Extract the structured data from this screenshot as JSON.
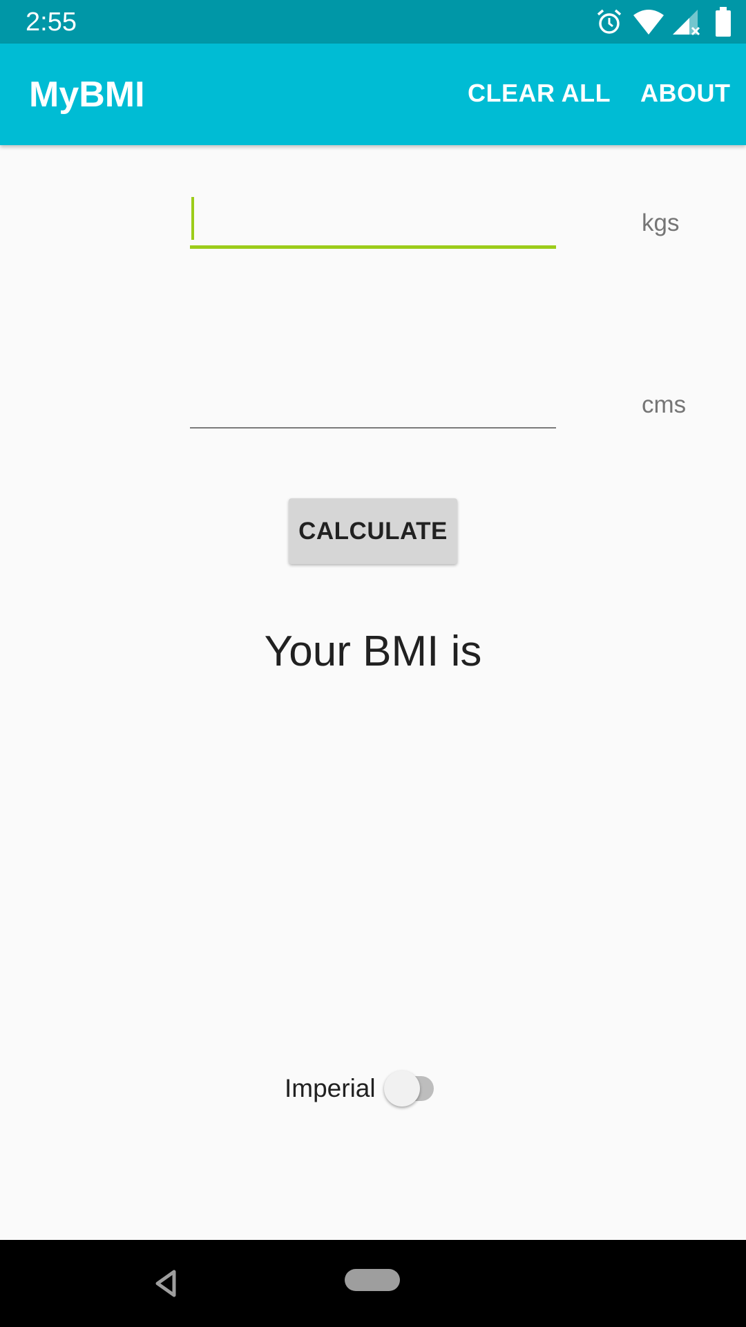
{
  "status_bar": {
    "time": "2:55",
    "icons": [
      "alarm-icon",
      "wifi-icon",
      "signal-icon",
      "battery-icon"
    ],
    "background": "#0097a7"
  },
  "app_bar": {
    "title": "MyBMI",
    "actions": [
      "CLEAR ALL",
      "ABOUT"
    ],
    "background": "#00bcd4"
  },
  "form": {
    "weight": {
      "value": "",
      "unit": "kgs",
      "focused": true,
      "accent": "#9ccc1a"
    },
    "height": {
      "value": "",
      "unit": "cms",
      "focused": false
    },
    "calculate_label": "CALCULATE"
  },
  "result": {
    "text": "Your BMI is"
  },
  "units_toggle": {
    "label": "Imperial",
    "checked": false
  },
  "nav_bar": {
    "icons": [
      "back-icon",
      "home-pill-icon"
    ]
  }
}
